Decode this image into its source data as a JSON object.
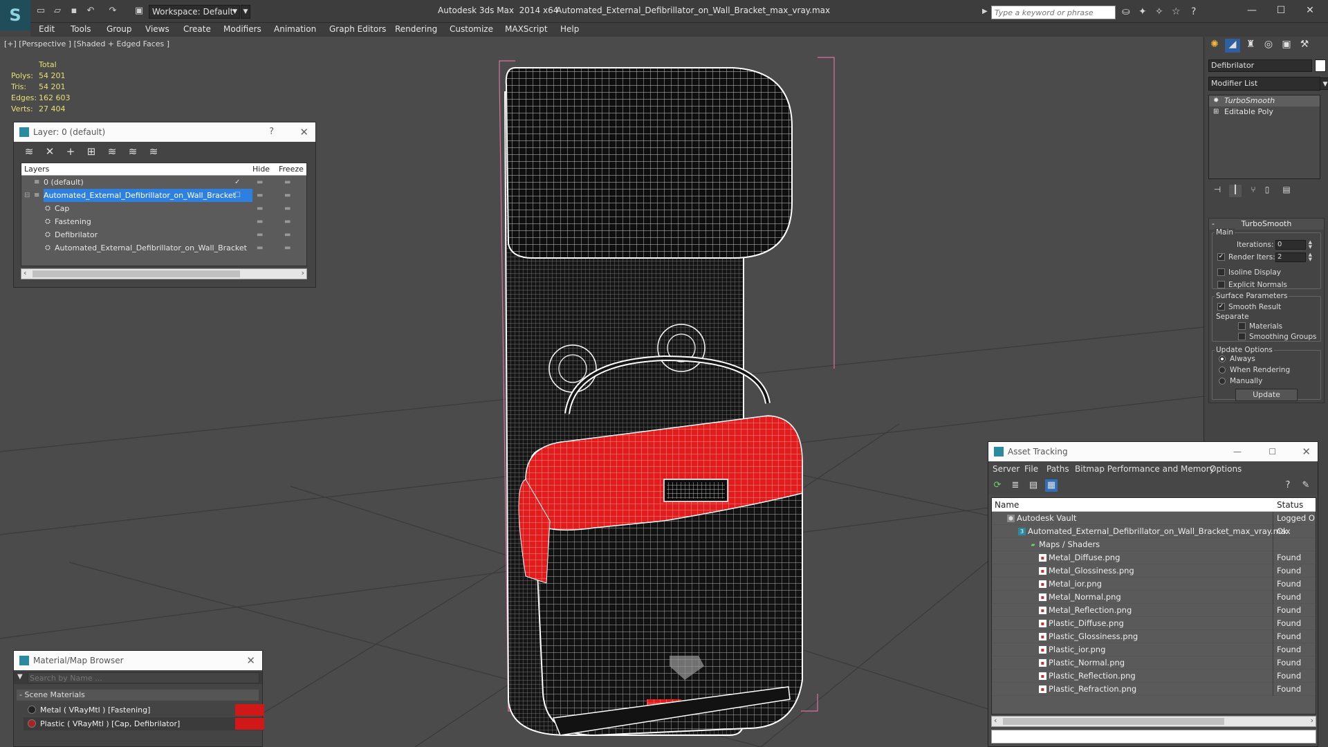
{
  "titlebar": {
    "app_title": "Autodesk 3ds Max  2014 x64",
    "file_title": "Automated_External_Defibrillator_on_Wall_Bracket_max_vray.max",
    "workspace": "Workspace: Default",
    "search_placeholder": "Type a keyword or phrase"
  },
  "menu": [
    "Edit",
    "Tools",
    "Group",
    "Views",
    "Create",
    "Modifiers",
    "Animation",
    "Graph Editors",
    "Rendering",
    "Customize",
    "MAXScript",
    "Help"
  ],
  "viewport": {
    "label": "[+] [Perspective ] [Shaded + Edged Faces ]",
    "stats": {
      "header": "Total",
      "rows": [
        {
          "k": "Polys:",
          "v": "54 201"
        },
        {
          "k": "Tris:",
          "v": "54 201"
        },
        {
          "k": "Edges:",
          "v": "162 603"
        },
        {
          "k": "Verts:",
          "v": "27 404"
        }
      ]
    }
  },
  "layer_panel": {
    "title": "Layer: 0 (default)",
    "help": "?",
    "columns": {
      "layers": "Layers",
      "hide": "Hide",
      "freeze": "Freeze"
    },
    "rows": [
      {
        "name": "0 (default)",
        "indent": 0
      },
      {
        "name": "Automated_External_Defibrillator_on_Wall_Bracket",
        "indent": 0
      },
      {
        "name": "Cap",
        "indent": 1
      },
      {
        "name": "Fastening",
        "indent": 1
      },
      {
        "name": "Defibrilator",
        "indent": 1
      },
      {
        "name": "Automated_External_Defibrillator_on_Wall_Bracket",
        "indent": 1
      }
    ]
  },
  "material_browser": {
    "title": "Material/Map Browser",
    "search_placeholder": "Search by Name ...",
    "group": "- Scene Materials",
    "items": [
      {
        "label": "Metal  ( VRayMtl ) [Fastening]"
      },
      {
        "label": "Plastic  ( VRayMtl ) [Cap, Defibrilator]"
      }
    ]
  },
  "command_panel": {
    "object_name": "Defibrilator",
    "modifier_list": "Modifier List",
    "stack": [
      {
        "label": "TurboSmooth"
      },
      {
        "label": "Editable Poly"
      }
    ],
    "turbosmooth": {
      "title": "TurboSmooth",
      "main_label": "Main",
      "iterations_label": "Iterations:",
      "iterations_value": "0",
      "render_iters_label": "Render Iters:",
      "render_iters_value": "2",
      "isoline_label": "Isoline Display",
      "explicit_normals_label": "Explicit Normals",
      "surface_label": "Surface Parameters",
      "smooth_result_label": "Smooth Result",
      "separate_label": "Separate",
      "materials_label": "Materials",
      "smoothing_groups_label": "Smoothing Groups",
      "update_options_label": "Update Options",
      "always_label": "Always",
      "when_rendering_label": "When Rendering",
      "manually_label": "Manually",
      "update_button": "Update"
    }
  },
  "asset_tracking": {
    "title": "Asset Tracking",
    "menu": [
      "Server",
      "File",
      "Paths",
      "Bitmap Performance and Memory",
      "Options"
    ],
    "columns": {
      "name": "Name",
      "status": "Status"
    },
    "rows": [
      {
        "name": "Autodesk Vault",
        "status": "Logged O",
        "indent": 1,
        "icon": "vault"
      },
      {
        "name": "Automated_External_Defibrillator_on_Wall_Bracket_max_vray.max",
        "status": "Ok",
        "indent": 2,
        "icon": "max"
      },
      {
        "name": "Maps / Shaders",
        "status": "",
        "indent": 3,
        "icon": "maps"
      },
      {
        "name": "Metal_Diffuse.png",
        "status": "Found",
        "indent": 4,
        "icon": "png"
      },
      {
        "name": "Metal_Glossiness.png",
        "status": "Found",
        "indent": 4,
        "icon": "png"
      },
      {
        "name": "Metal_ior.png",
        "status": "Found",
        "indent": 4,
        "icon": "png"
      },
      {
        "name": "Metal_Normal.png",
        "status": "Found",
        "indent": 4,
        "icon": "png"
      },
      {
        "name": "Metal_Reflection.png",
        "status": "Found",
        "indent": 4,
        "icon": "png"
      },
      {
        "name": "Plastic_Diffuse.png",
        "status": "Found",
        "indent": 4,
        "icon": "png"
      },
      {
        "name": "Plastic_Glossiness.png",
        "status": "Found",
        "indent": 4,
        "icon": "png"
      },
      {
        "name": "Plastic_ior.png",
        "status": "Found",
        "indent": 4,
        "icon": "png"
      },
      {
        "name": "Plastic_Normal.png",
        "status": "Found",
        "indent": 4,
        "icon": "png"
      },
      {
        "name": "Plastic_Reflection.png",
        "status": "Found",
        "indent": 4,
        "icon": "png"
      },
      {
        "name": "Plastic_Refraction.png",
        "status": "Found",
        "indent": 4,
        "icon": "png"
      }
    ]
  },
  "colors": {
    "selection_blue": "#2e80e0",
    "stats_yellow": "#e8e070",
    "selected_mesh_red": "#e02020",
    "wire_white": "#ffffff",
    "bbox_pink": "#e070a0"
  }
}
